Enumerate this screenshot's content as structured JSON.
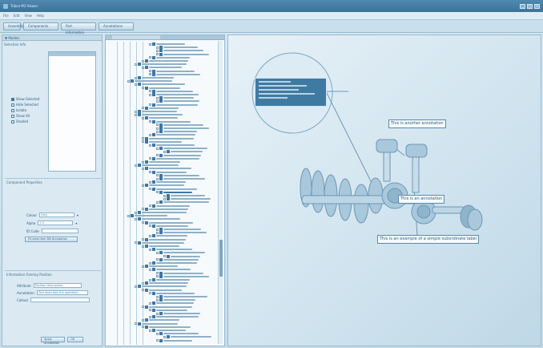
{
  "window": {
    "title": "Tribon M3 Viewer",
    "controls": [
      "_",
      "□",
      "×"
    ]
  },
  "menubar": {
    "items": [
      "File",
      "Edit",
      "View",
      "Help"
    ]
  },
  "toolbar": {
    "tabs": [
      "Assembly",
      "Components",
      "Part Information",
      "Annotations"
    ]
  },
  "left_panel": {
    "header": "▼ Models",
    "section1_title": "Selection Info",
    "radios": [
      "Show Selected",
      "Hide Selected",
      "Isolate",
      "Show All",
      "Shaded"
    ],
    "section2_title": "Component Properties",
    "fields": [
      {
        "label": "Colour",
        "value": "Grey"
      },
      {
        "label": "Alpha",
        "value": "1.0"
      },
      {
        "label": "ID Code",
        "value": ""
      }
    ],
    "apply_button": "Fit view from DB Annotation",
    "section3_title": "Information Overlay Position",
    "text_fields": [
      {
        "label": "Attribute",
        "value": "Position Description"
      },
      {
        "label": "Annotation",
        "value": "Text describes the operation"
      },
      {
        "label": "Callout",
        "value": ""
      }
    ],
    "ok_button": "Apply Annotation",
    "small_button": "OK"
  },
  "viewport": {
    "annotations": [
      "This is another annotation",
      "This is an annotation",
      "This is an example of a simple subordinate label"
    ]
  }
}
